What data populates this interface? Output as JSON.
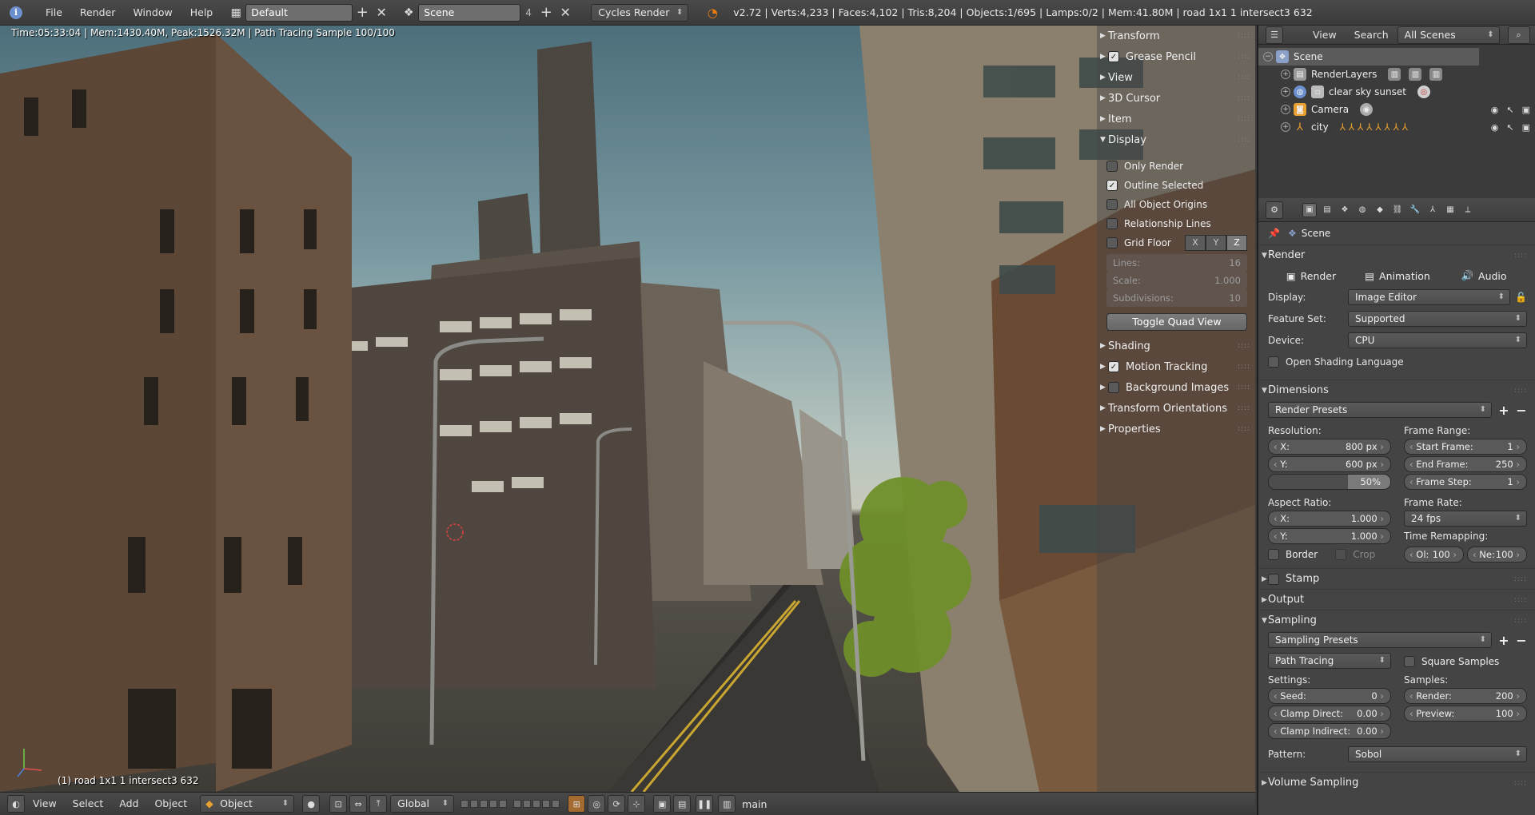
{
  "topbar": {
    "menus": [
      "File",
      "Render",
      "Window",
      "Help"
    ],
    "screen_layout": "Default",
    "scene_name": "Scene",
    "scene_users": "4",
    "render_engine": "Cycles Render",
    "stats": "v2.72 | Verts:4,233 | Faces:4,102 | Tris:8,204 | Objects:1/695 | Lamps:0/2 | Mem:41.80M | road 1x1 1 intersect3 632"
  },
  "viewport": {
    "render_info": "Time:05:33:04 | Mem:1430.40M, Peak:1526.32M | Path Tracing Sample 100/100",
    "object_label": "(1) road 1x1 1 intersect3 632"
  },
  "npanel": {
    "sections": {
      "transform": "Transform",
      "grease_pencil": "Grease Pencil",
      "view": "View",
      "cursor": "3D Cursor",
      "item": "Item",
      "display": "Display"
    },
    "display": {
      "only_render": "Only Render",
      "outline_selected": "Outline Selected",
      "all_object_origins": "All Object Origins",
      "relationship_lines": "Relationship Lines",
      "grid_floor": "Grid Floor",
      "axis_x": "X",
      "axis_y": "Y",
      "axis_z": "Z",
      "lines_label": "Lines:",
      "lines_value": "16",
      "scale_label": "Scale:",
      "scale_value": "1.000",
      "subdivisions_label": "Subdivisions:",
      "subdivisions_value": "10",
      "toggle_quad_view": "Toggle Quad View"
    },
    "more_sections": {
      "shading": "Shading",
      "motion_tracking": "Motion Tracking",
      "background_images": "Background Images",
      "transform_orientations": "Transform Orientations",
      "properties": "Properties"
    }
  },
  "bottombar": {
    "menus": [
      "View",
      "Select",
      "Add",
      "Object"
    ],
    "mode": "Object Mode",
    "orientation": "Global",
    "render_layer": "main"
  },
  "outliner": {
    "header": {
      "view": "View",
      "search": "Search",
      "display_mode": "All Scenes"
    },
    "items": {
      "scene": "Scene",
      "render_layers": "RenderLayers",
      "world": "clear sky sunset",
      "camera": "Camera",
      "city": "city"
    }
  },
  "properties": {
    "context": "Scene",
    "render": {
      "title": "Render",
      "render_btn": "Render",
      "animation_btn": "Animation",
      "audio_btn": "Audio",
      "display_label": "Display:",
      "display_value": "Image Editor",
      "feature_set_label": "Feature Set:",
      "feature_set_value": "Supported",
      "device_label": "Device:",
      "device_value": "CPU",
      "osl": "Open Shading Language"
    },
    "dimensions": {
      "title": "Dimensions",
      "presets": "Render Presets",
      "resolution": "Resolution:",
      "res_x_label": "X:",
      "res_x": "800 px",
      "res_y_label": "Y:",
      "res_y": "600 px",
      "res_pct": "50%",
      "frame_range": "Frame Range:",
      "start_label": "Start Frame:",
      "start": "1",
      "end_label": "End Frame:",
      "end": "250",
      "step_label": "Frame Step:",
      "step": "1",
      "aspect": "Aspect Ratio:",
      "asp_x_label": "X:",
      "asp_x": "1.000",
      "asp_y_label": "Y:",
      "asp_y": "1.000",
      "frame_rate": "Frame Rate:",
      "fps": "24 fps",
      "time_remap": "Time Remapping:",
      "old_label": "Ol:",
      "old": "100",
      "new_label": "Ne:",
      "new": "100",
      "border": "Border",
      "crop": "Crop"
    },
    "collapsed": {
      "stamp": "Stamp",
      "output": "Output"
    },
    "sampling": {
      "title": "Sampling",
      "presets": "Sampling Presets",
      "integrator": "Path Tracing",
      "square_samples": "Square Samples",
      "settings": "Settings:",
      "seed_label": "Seed:",
      "seed": "0",
      "clamp_direct_label": "Clamp Direct:",
      "clamp_direct": "0.00",
      "clamp_indirect_label": "Clamp Indirect:",
      "clamp_indirect": "0.00",
      "samples": "Samples:",
      "render_label": "Render:",
      "render": "200",
      "preview_label": "Preview:",
      "preview": "100",
      "pattern_label": "Pattern:",
      "pattern": "Sobol"
    },
    "volume_sampling": "Volume Sampling"
  },
  "colors": {
    "accent": "#6c8fcf",
    "blender_orange": "#e87d0d",
    "viewport_sky": "#5d7f89"
  }
}
